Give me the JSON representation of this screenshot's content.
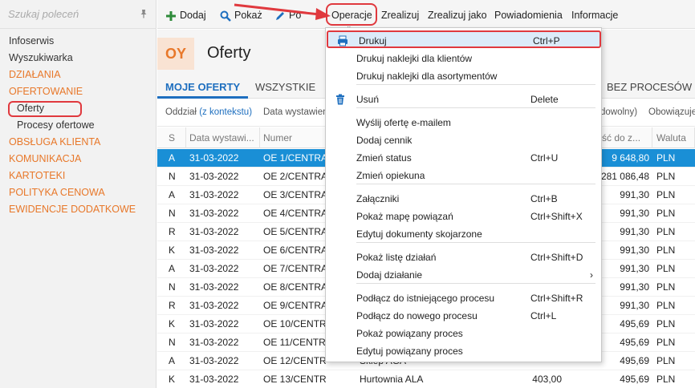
{
  "search": {
    "placeholder": "Szukaj poleceń"
  },
  "sidebar": {
    "items": [
      {
        "label": "Infoserwis",
        "type": "item"
      },
      {
        "label": "Wyszukiwarka",
        "type": "item"
      },
      {
        "label": "DZIAŁANIA",
        "type": "section"
      },
      {
        "label": "OFERTOWANIE",
        "type": "section"
      },
      {
        "label": "Oferty",
        "type": "sub-active"
      },
      {
        "label": "Procesy ofertowe",
        "type": "sub"
      },
      {
        "label": "OBSŁUGA KLIENTA",
        "type": "section"
      },
      {
        "label": "KOMUNIKACJA",
        "type": "section"
      },
      {
        "label": "KARTOTEKI",
        "type": "section"
      },
      {
        "label": "POLITYKA CENOWA",
        "type": "section"
      },
      {
        "label": "EWIDENCJE DODATKOWE",
        "type": "section"
      }
    ]
  },
  "toolbar": {
    "add_label": "Dodaj",
    "show_label": "Pokaż",
    "pop_label": "Po",
    "operations_label": "Operacje",
    "realize_label": "Zrealizuj",
    "realize_as_label": "Zrealizuj jako",
    "notifications_label": "Powiadomienia",
    "info_label": "Informacje"
  },
  "header": {
    "badge": "OY",
    "title": "Oferty"
  },
  "tabs": [
    {
      "label": "MOJE OFERTY",
      "active": true
    },
    {
      "label": "WSZYSTKIE",
      "active": false
    },
    {
      "label": "BEZ PROCESÓW",
      "active": false
    }
  ],
  "filters": {
    "branch_label": "Oddział",
    "branch_value": "(z kontekstu)",
    "date_label": "Data wystawien",
    "any_label": "dowolny)",
    "required_label": "Obowiązuje"
  },
  "columns": {
    "s": "S",
    "date": "Data wystawi...",
    "number": "Numer",
    "value": "tość do z...",
    "currency": "Waluta"
  },
  "rows": [
    {
      "s": "A",
      "date": "31-03-2022",
      "number": "OE 1/CENTRAL",
      "name": "",
      "netto": "",
      "value": "9 648,80",
      "currency": "PLN",
      "selected": true
    },
    {
      "s": "N",
      "date": "31-03-2022",
      "number": "OE 2/CENTRAL",
      "name": "",
      "netto": "",
      "value": "281 086,48",
      "currency": "PLN"
    },
    {
      "s": "A",
      "date": "31-03-2022",
      "number": "OE 3/CENTRAL",
      "name": "",
      "netto": "",
      "value": "991,30",
      "currency": "PLN"
    },
    {
      "s": "N",
      "date": "31-03-2022",
      "number": "OE 4/CENTRAL",
      "name": "",
      "netto": "",
      "value": "991,30",
      "currency": "PLN"
    },
    {
      "s": "R",
      "date": "31-03-2022",
      "number": "OE 5/CENTRAL",
      "name": "",
      "netto": "",
      "value": "991,30",
      "currency": "PLN"
    },
    {
      "s": "K",
      "date": "31-03-2022",
      "number": "OE 6/CENTRAL",
      "name": "",
      "netto": "",
      "value": "991,30",
      "currency": "PLN"
    },
    {
      "s": "A",
      "date": "31-03-2022",
      "number": "OE 7/CENTRAL",
      "name": "",
      "netto": "",
      "value": "991,30",
      "currency": "PLN"
    },
    {
      "s": "N",
      "date": "31-03-2022",
      "number": "OE 8/CENTRAL",
      "name": "",
      "netto": "",
      "value": "991,30",
      "currency": "PLN"
    },
    {
      "s": "R",
      "date": "31-03-2022",
      "number": "OE 9/CENTRAL",
      "name": "",
      "netto": "",
      "value": "991,30",
      "currency": "PLN"
    },
    {
      "s": "K",
      "date": "31-03-2022",
      "number": "OE 10/CENTRA",
      "name": "",
      "netto": "",
      "value": "495,69",
      "currency": "PLN"
    },
    {
      "s": "N",
      "date": "31-03-2022",
      "number": "OE 11/CENTRA",
      "name": "",
      "netto": "",
      "value": "495,69",
      "currency": "PLN"
    },
    {
      "s": "A",
      "date": "31-03-2022",
      "number": "OE 12/CENTRA",
      "name": "Sklep AGA",
      "netto": "",
      "value": "495,69",
      "currency": "PLN"
    },
    {
      "s": "K",
      "date": "31-03-2022",
      "number": "OE 13/CENTRALA/...",
      "name": "Hurtownia ALA",
      "netto": "403,00",
      "value": "495,69",
      "currency": "PLN"
    }
  ],
  "menu": {
    "items": [
      {
        "label": "Drukuj",
        "shortcut": "Ctrl+P",
        "icon": "printer-icon",
        "highlighted": true
      },
      {
        "label": "Drukuj naklejki dla klientów",
        "shortcut": ""
      },
      {
        "label": "Drukuj naklejki dla asortymentów",
        "shortcut": ""
      },
      {
        "label": "Usuń",
        "shortcut": "Delete",
        "icon": "trash-icon"
      },
      {
        "label": "Wyślij ofertę e-mailem",
        "shortcut": ""
      },
      {
        "label": "Dodaj cennik",
        "shortcut": ""
      },
      {
        "label": "Zmień status",
        "shortcut": "Ctrl+U"
      },
      {
        "label": "Zmień opiekuna",
        "shortcut": ""
      },
      {
        "label": "Załączniki",
        "shortcut": "Ctrl+B"
      },
      {
        "label": "Pokaż mapę powiązań",
        "shortcut": "Ctrl+Shift+X"
      },
      {
        "label": "Edytuj dokumenty skojarzone",
        "shortcut": ""
      },
      {
        "label": "Pokaż listę działań",
        "shortcut": "Ctrl+Shift+D"
      },
      {
        "label": "Dodaj działanie",
        "shortcut": "",
        "submenu": "›"
      },
      {
        "label": "Podłącz do istniejącego procesu",
        "shortcut": "Ctrl+Shift+R"
      },
      {
        "label": "Podłącz do nowego procesu",
        "shortcut": "Ctrl+L"
      },
      {
        "label": "Pokaż powiązany proces",
        "shortcut": ""
      },
      {
        "label": "Edytuj powiązany proces",
        "shortcut": ""
      }
    ]
  },
  "colors": {
    "accent": "#e8782a",
    "selection": "#1a8fd6",
    "annotation": "#e0393e",
    "link": "#1e6fbf"
  }
}
